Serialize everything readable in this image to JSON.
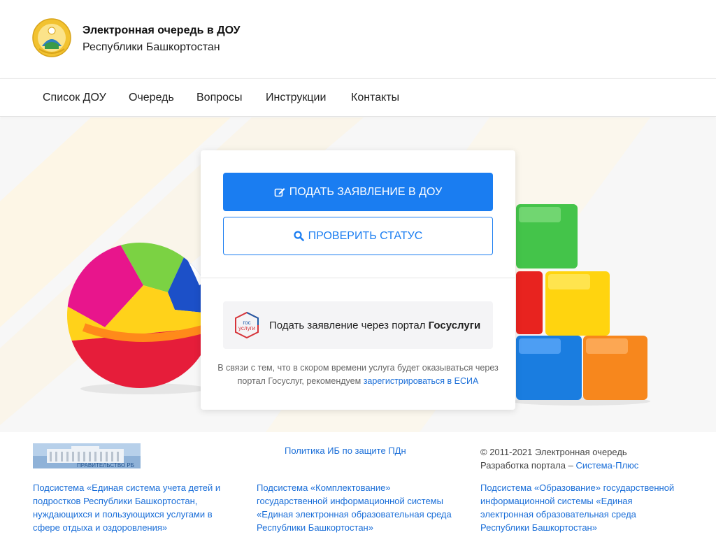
{
  "header": {
    "title": "Электронная очередь в ДОУ",
    "subtitle": "Республики Башкортостан",
    "logo_icon": "bashkortostan-emblem"
  },
  "nav": {
    "items": [
      {
        "label": "Список ДОУ"
      },
      {
        "label": "Очередь"
      },
      {
        "label": "Вопросы"
      },
      {
        "label": "Инструкции"
      },
      {
        "label": "Контакты"
      }
    ]
  },
  "card": {
    "apply_label": "ПОДАТЬ ЗАЯВЛЕНИЕ В ДОУ",
    "apply_icon": "edit-icon",
    "status_label": "ПРОВЕРИТЬ СТАТУС",
    "status_icon": "search-icon",
    "gosuslugi_prefix": "Подать заявление через портал",
    "gosuslugi_name": "Госуслуги",
    "gosuslugi_logo_text_1": "гос",
    "gosuslugi_logo_text_2": "услуги",
    "note_text": "В связи с тем, что в скором времени услуга будет оказываться через портал Госуслуг, рекомендуем",
    "note_link": "зарегистрироваться в ЕСИА"
  },
  "footer": {
    "gov_banner_text": "ПРАВИТЕЛЬСТВО РБ",
    "policy_link": "Политика ИБ по защите ПДн",
    "copyright": "© 2011-2021 Электронная очередь",
    "dev_prefix": "Разработка портала –",
    "dev_link": "Система-Плюс",
    "col1_link": "Подсистема «Единая система учета детей и подростков Республики Башкортостан, нуждающихся и пользующихся услугами в сфере отдыха и оздоровления» государственной",
    "col2_link": "Подсистема «Комплектование» государственной информационной системы «Единая электронная образовательная среда Республики Башкортостан»",
    "col3_link": "Подсистема «Образование» государственной информационной системы «Единая электронная образовательная среда Республики Башкортостан»"
  },
  "colors": {
    "primary": "#1a7df1",
    "link": "#1a6ed8"
  }
}
